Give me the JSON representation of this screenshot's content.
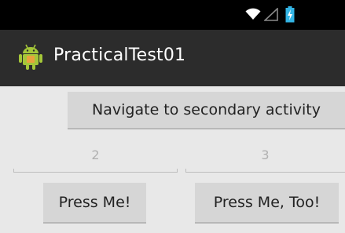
{
  "app": {
    "title": "PracticalTest01"
  },
  "status_bar": {
    "icons": [
      "wifi-icon",
      "signal-icon",
      "battery-icon"
    ]
  },
  "main": {
    "navigate_label": "Navigate to secondary activity",
    "left_value": "2",
    "right_value": "3",
    "press_me_label": "Press Me!",
    "press_me_too_label": "Press Me, Too!"
  },
  "colors": {
    "status_bar": "#000000",
    "action_bar": "#2c2c2c",
    "background": "#e8e8e8",
    "button": "#d6d6d6",
    "battery_accent": "#33b5e5"
  }
}
